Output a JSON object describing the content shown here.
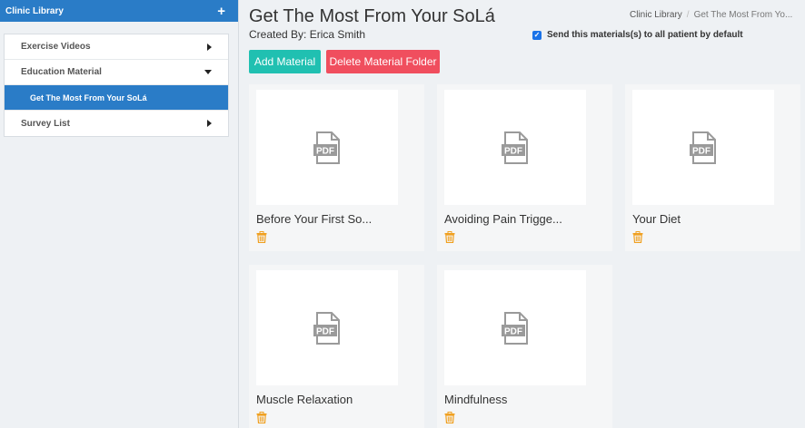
{
  "sidebar": {
    "header": {
      "title": "Clinic Library",
      "add_symbol": "+"
    },
    "items": [
      {
        "label": "Exercise Videos"
      },
      {
        "label": "Education Material"
      },
      {
        "label": "Get The Most From Your SoLá"
      },
      {
        "label": "Survey List"
      }
    ]
  },
  "header": {
    "title": "Get The Most From Your SoLá",
    "created_by": "Created By: Erica Smith",
    "breadcrumb": {
      "root": "Clinic Library",
      "separator": "/",
      "current": "Get The Most From Yo..."
    },
    "send_default_label": "Send this materials(s) to all patient by default"
  },
  "actions": {
    "add_label": "Add Material",
    "delete_label": "Delete Material Folder"
  },
  "materials": [
    {
      "title": "Before Your First So...",
      "icon": "pdf-icon"
    },
    {
      "title": "Avoiding Pain Trigge...",
      "icon": "pdf-icon"
    },
    {
      "title": "Your Diet",
      "icon": "pdf-icon"
    },
    {
      "title": "Muscle Relaxation",
      "icon": "pdf-icon"
    },
    {
      "title": "Mindfulness",
      "icon": "pdf-icon"
    }
  ],
  "colors": {
    "primary": "#2a7cc7",
    "add": "#20c0b1",
    "delete": "#f04e5e",
    "trash": "#f0a020"
  }
}
